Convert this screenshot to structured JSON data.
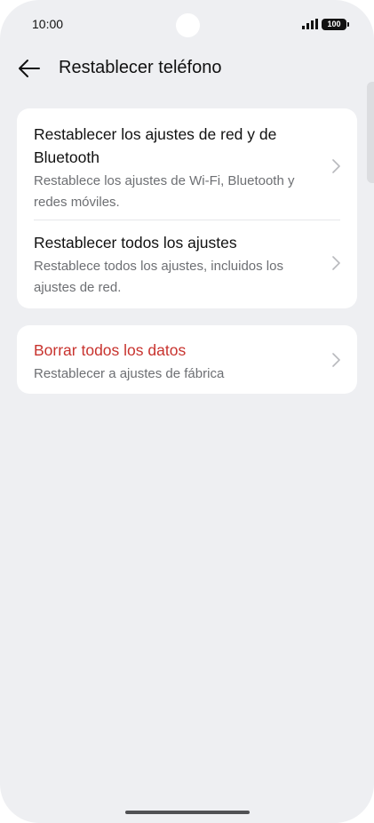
{
  "status_bar": {
    "time": "10:00",
    "battery": "100",
    "signal_icon": "cellular-signal-icon",
    "battery_icon": "battery-icon"
  },
  "header": {
    "back_icon": "arrow-left-icon",
    "title": "Restablecer teléfono"
  },
  "groups": [
    {
      "items": [
        {
          "title": "Restablecer los ajustes de red y de Bluetooth",
          "subtitle": "Restablece los ajustes de Wi-Fi, Bluetooth y redes móviles.",
          "icon": "chevron-right-icon"
        },
        {
          "title": "Restablecer todos los ajustes",
          "subtitle": "Restablece todos los ajustes, incluidos los ajustes de red.",
          "icon": "chevron-right-icon"
        }
      ]
    },
    {
      "items": [
        {
          "title": "Borrar todos los datos",
          "subtitle": "Restablecer a ajustes de fábrica",
          "icon": "chevron-right-icon",
          "title_color": "#c8332e"
        }
      ]
    }
  ],
  "colors": {
    "background": "#eeeff2",
    "card": "#ffffff",
    "danger": "#c8332e",
    "subtitle": "#6d6f73"
  }
}
